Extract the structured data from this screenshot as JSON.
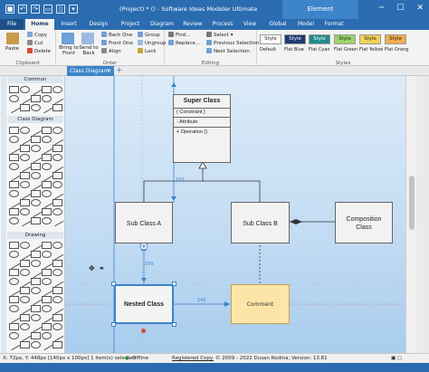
{
  "titlebar": {
    "title": "(Project) * () - Software Ideas Modeler Ultimate",
    "context_tab": "Element",
    "quick_access_icons": [
      "save-icon",
      "undo-icon",
      "redo-icon",
      "folder-icon",
      "doc-icon",
      "dropdown-icon"
    ],
    "window_controls": [
      "─",
      "☐",
      "✕"
    ]
  },
  "tabs": [
    {
      "label": "File"
    },
    {
      "label": "Home"
    },
    {
      "label": "Insert"
    },
    {
      "label": "Design"
    },
    {
      "label": "Project"
    },
    {
      "label": "Diagram"
    },
    {
      "label": "Review"
    },
    {
      "label": "Process"
    },
    {
      "label": "View"
    },
    {
      "label": "Global"
    },
    {
      "label": "Model"
    },
    {
      "label": "Format"
    }
  ],
  "ribbon": {
    "clipboard": {
      "paste": "Paste",
      "copy": "Copy",
      "cut": "Cut",
      "delete": "Delete",
      "label": "Clipboard"
    },
    "order": {
      "bring_front": "Bring to Front",
      "send_back": "Send to Back",
      "back_one": "Back One",
      "front_one": "Front One",
      "align": "Align",
      "label": "Order"
    },
    "group": {
      "group": "Group",
      "ungroup": "Ungroup",
      "lock": "Lock"
    },
    "editing": {
      "find": "Find...",
      "replace": "Replace...",
      "select": "Select",
      "prev_selection": "Previous Selection",
      "next_selection": "Next Selection",
      "label": "Editing"
    },
    "styles": {
      "label": "Styles",
      "items": [
        {
          "box": "Style",
          "name": "Default",
          "bg": "#ffffff",
          "fg": "#222222"
        },
        {
          "box": "Style",
          "name": "Flat Blue",
          "bg": "#1f3a70",
          "fg": "#ffffff"
        },
        {
          "box": "Style",
          "name": "Flat Cyan",
          "bg": "#1f8a8a",
          "fg": "#ffffff"
        },
        {
          "box": "Style",
          "name": "Flat Green",
          "bg": "#9cd46a",
          "fg": "#222222"
        },
        {
          "box": "Style",
          "name": "Flat Yellow",
          "bg": "#f4d25a",
          "fg": "#222222"
        },
        {
          "box": "Style",
          "name": "Flat Orang",
          "bg": "#f2ad4e",
          "fg": "#222222"
        }
      ]
    }
  },
  "doc_tab": {
    "label": "Class Diagram",
    "close": "✕",
    "add": "+"
  },
  "toolbox": {
    "sections": [
      "Common",
      "Class Diagram",
      "Drawing"
    ]
  },
  "diagram": {
    "super_class": {
      "name": "Super Class",
      "constraint": "{ Constraint }",
      "attribute": "- Attribute",
      "operation": "+ Operation ()"
    },
    "sub_a": {
      "name": "Sub Class A"
    },
    "sub_b": {
      "name": "Sub Class B"
    },
    "composition": {
      "name": "Composition Class"
    },
    "nested": {
      "name": "Nested Class"
    },
    "comment": {
      "text": "Comment"
    },
    "dim_labels": {
      "vertical_top": "100",
      "vertical_bottom": "100",
      "horizontal": "140"
    }
  },
  "statusbar": {
    "coords": "X: 72px, Y: 448px [140px x 100px] 1 item(s) selected",
    "mode": "Offline",
    "registered": "Registered Copy.",
    "copyright": "© 2009 - 2022 Dusan Rodina; Version: 13.81"
  },
  "colors": {
    "accent": "#2b6cb0",
    "canvas_top": "#dcebf8",
    "canvas_bottom": "#a9cdee",
    "selection": "#3d84c9"
  }
}
